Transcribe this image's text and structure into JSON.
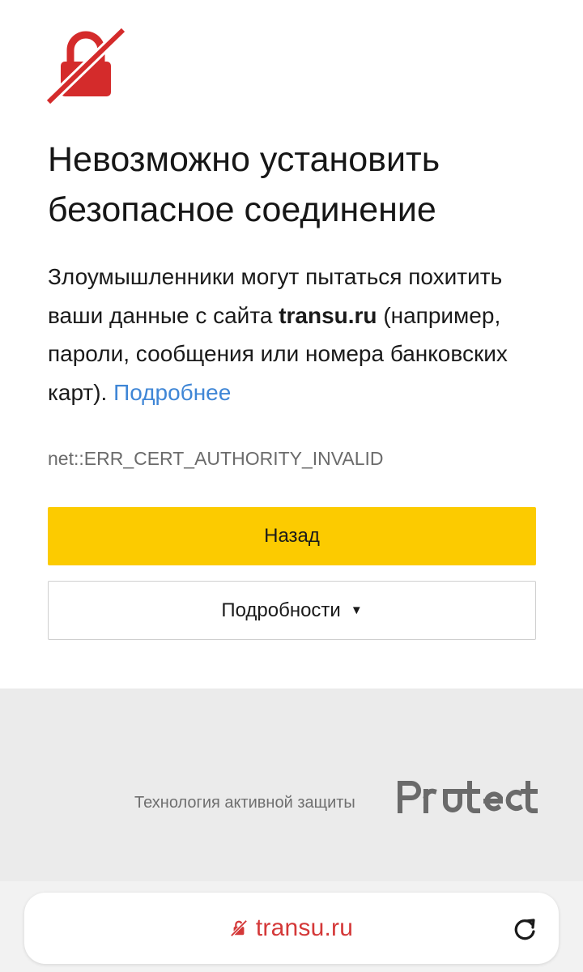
{
  "page": {
    "title_line1": "Невозможно установить",
    "title_line2": "безопасное соединение",
    "desc_part1": "Злоумышленники могут пытаться похитить ваши данные с сайта ",
    "site": "transu.ru",
    "desc_part2": " (например, пароли, сообщения или номера банковских карт). ",
    "more_link": "Подробнее",
    "error_code": "net::ERR_CERT_AUTHORITY_INVALID"
  },
  "buttons": {
    "back_label": "Назад",
    "details_label": "Подробности",
    "details_caret": "▼"
  },
  "footer": {
    "text": "Технология активной защиты",
    "logo_text": "Protect"
  },
  "address_bar": {
    "url": "transu.ru"
  },
  "colors": {
    "accent_yellow": "#fccb00",
    "error_red": "#d32f2f",
    "link_blue": "#3f86d6",
    "url_red": "#d43838"
  },
  "icons": {
    "main": "broken-lock-icon",
    "url": "broken-lock-icon",
    "reload": "reload-icon",
    "caret": "triangle-down-icon"
  }
}
